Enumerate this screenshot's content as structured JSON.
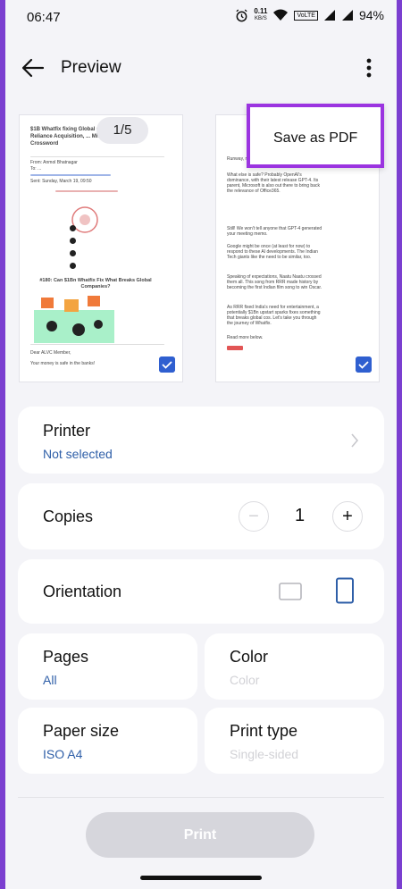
{
  "status_bar": {
    "time": "06:47",
    "net_speed": "0.11",
    "net_unit": "KB/S",
    "volte": "VoLTE",
    "battery": "94%"
  },
  "app_bar": {
    "title": "Preview"
  },
  "menu": {
    "save_pdf": "Save as PDF"
  },
  "preview": {
    "page_indicator": "1/5",
    "page1": {
      "headline": "$1B Whatfix fixing Global Gr... Haptik's Reliance Acquisition, ... Minimalist AMA, Crossword",
      "from": "From: Anmol Bhatnagar",
      "to": "To: ...",
      "date": "Sent: Sunday, March 19, 09:50",
      "story": "#180: Can $1Bn Whatfix Fix What Breaks Global Companies?",
      "greeting": "Dear ALVC Member,",
      "closing": "Your money is safe in the banks!"
    },
    "page2": {
      "p1": "Runway, not runaway. Damn, isn't it?",
      "p2": "What else is safe? Probably OpenAI's dominance, with their latest release GPT-4. Its parent, Microsoft is also out there to bring back the relevance of Office365.",
      "p3": "Still! We won't tell anyone that GPT-4 generated your meeting memo.",
      "p4": "Google might be once (at least for now) to respond to these AI developments. The Indian Tech giants like the need to be similar, too.",
      "p5": "Speaking of expectations, Naatu Naatu crossed them all. This song from RRR made history by becoming the first Indian film song to win Oscar.",
      "p6": "As RRR fixed India's need for entertainment, a potentially $1Bn upstart sparks fixes something that breaks global cos. Let's take you through the journey of Whatfix.",
      "p7": "Read more below."
    }
  },
  "settings": {
    "printer": {
      "label": "Printer",
      "value": "Not selected"
    },
    "copies": {
      "label": "Copies",
      "value": "1",
      "minus": "−",
      "plus": "+"
    },
    "orientation": {
      "label": "Orientation"
    },
    "pages": {
      "label": "Pages",
      "value": "All"
    },
    "color": {
      "label": "Color",
      "value": "Color"
    },
    "paper_size": {
      "label": "Paper size",
      "value": "ISO A4"
    },
    "print_type": {
      "label": "Print type",
      "value": "Single-sided"
    }
  },
  "print_button": "Print",
  "colors": {
    "accent": "#2f5fd0",
    "highlight_border": "#9b34e0",
    "link": "#2f5fa8"
  }
}
